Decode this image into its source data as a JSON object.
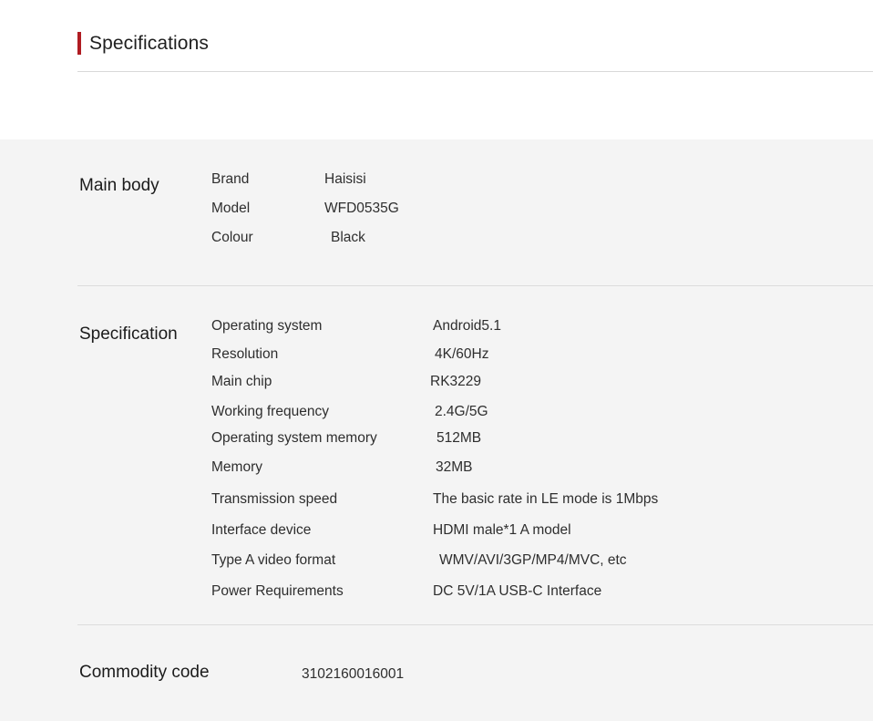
{
  "header": {
    "title": "Specifications",
    "accent_color": "#b01c22"
  },
  "colors": {
    "page_background": "#ffffff",
    "panel_background": "#f4f4f4",
    "divider": "#dcdcdc",
    "text": "#2e2e2e"
  },
  "sections": [
    {
      "id": "main-body",
      "label": "Main body",
      "rows": [
        {
          "label": "Brand",
          "value": "Haisisi"
        },
        {
          "label": "Model",
          "value": "WFD0535G"
        },
        {
          "label": "Colour",
          "value": "Black"
        }
      ]
    },
    {
      "id": "specification",
      "label": "Specification",
      "rows": [
        {
          "label": "Operating system",
          "value": "Android5.1"
        },
        {
          "label": "Resolution",
          "value": "4K/60Hz"
        },
        {
          "label": "Main chip",
          "value": "RK3229"
        },
        {
          "label": "Working frequency",
          "value": "2.4G/5G"
        },
        {
          "label": "Operating system memory",
          "value": "512MB"
        },
        {
          "label": "Memory",
          "value": "32MB"
        },
        {
          "label": "Transmission speed",
          "value": "The basic rate in LE mode is 1Mbps"
        },
        {
          "label": "Interface device",
          "value": "HDMI male*1 A model"
        },
        {
          "label": "Type A video format",
          "value": "WMV/AVI/3GP/MP4/MVC, etc"
        },
        {
          "label": "Power Requirements",
          "value": "DC 5V/1A USB-C Interface"
        }
      ]
    },
    {
      "id": "commodity",
      "label": "Commodity code",
      "value": "3102160016001"
    }
  ]
}
